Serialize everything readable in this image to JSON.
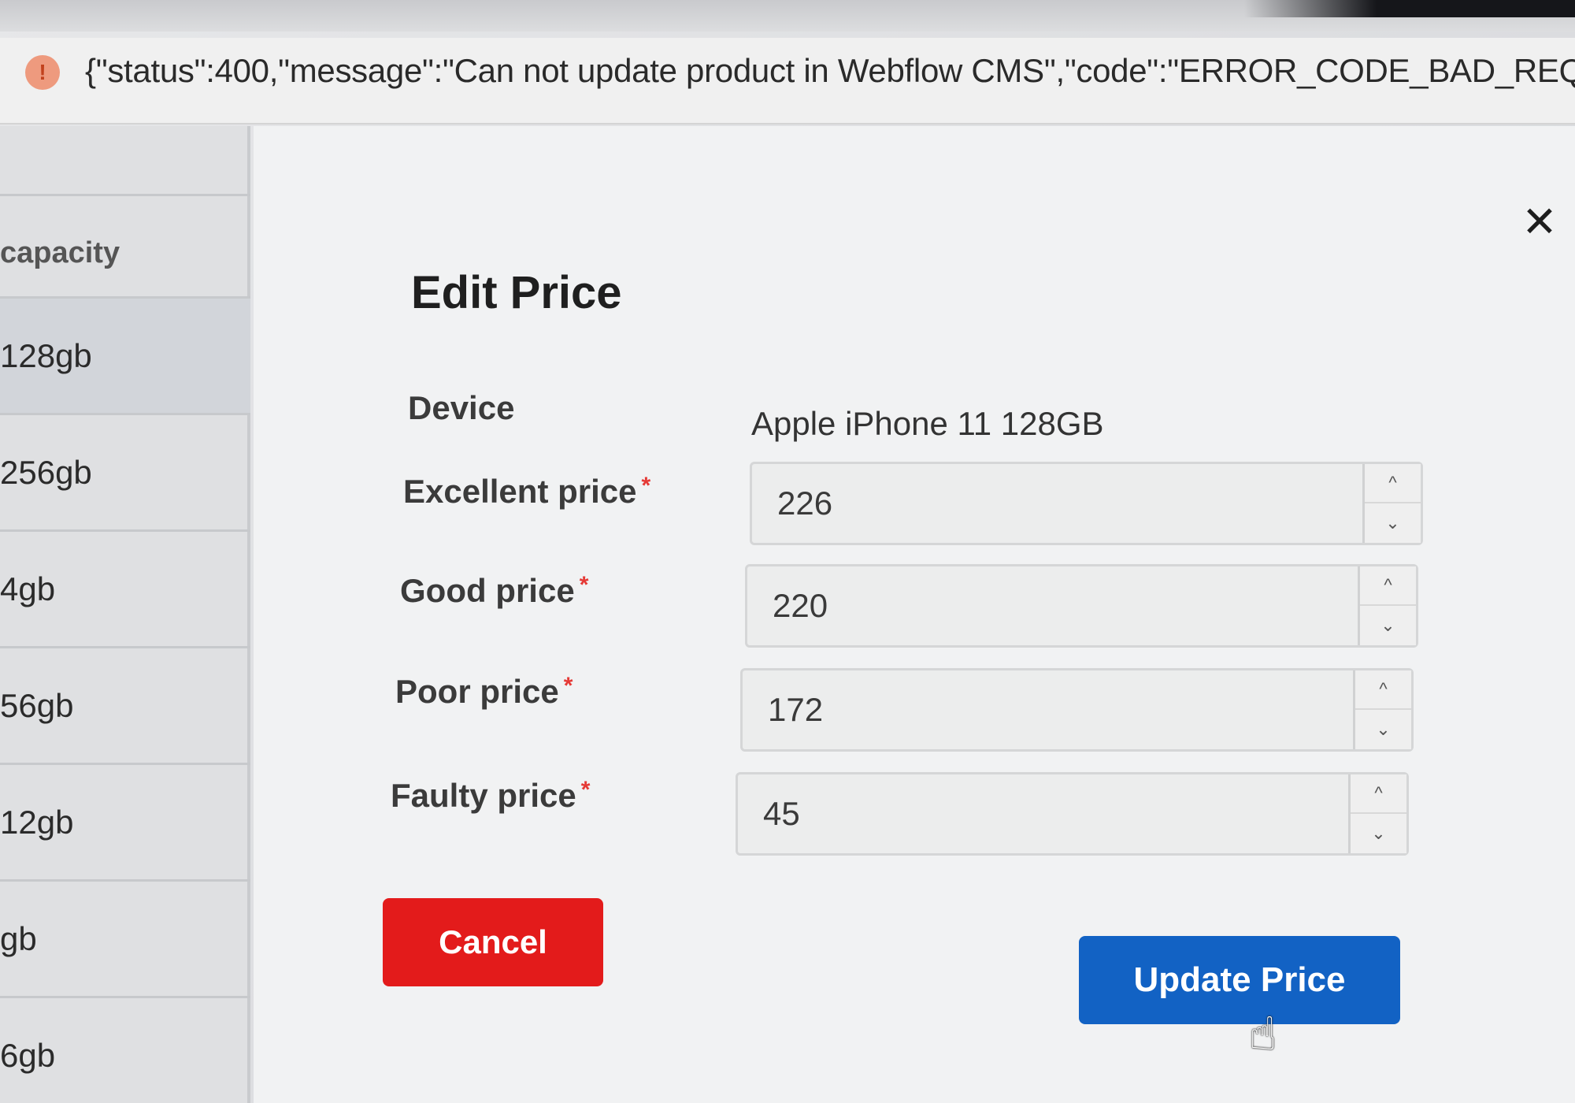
{
  "toast": {
    "icon": "warning-icon",
    "message": "{\"status\":400,\"message\":\"Can not update product in Webflow CMS\",\"code\":\"ERROR_CODE_BAD_REQ"
  },
  "table": {
    "header": "capacity",
    "rows": [
      "128gb",
      "256gb",
      "4gb",
      "56gb",
      "12gb",
      "gb",
      "6gb"
    ]
  },
  "dialog": {
    "title": "Edit Price",
    "close_icon": "close-icon",
    "device_label": "Device",
    "device_value": "Apple iPhone 11 128GB",
    "required_mark": "*",
    "fields": [
      {
        "label": "Excellent price",
        "value": "226"
      },
      {
        "label": "Good price",
        "value": "220"
      },
      {
        "label": "Poor price",
        "value": "172"
      },
      {
        "label": "Faulty price",
        "value": "45"
      }
    ],
    "cancel_label": "Cancel",
    "update_label": "Update Price"
  },
  "colors": {
    "cancel": "#e31b1b",
    "update": "#1262c4",
    "required": "#e53935"
  }
}
